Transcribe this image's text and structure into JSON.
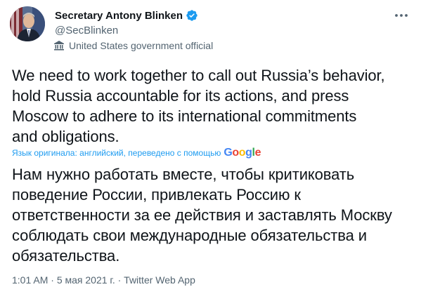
{
  "author": {
    "display_name": "Secretary Antony Blinken",
    "handle": "@SecBlinken",
    "label": "United States government official"
  },
  "tweet": {
    "text": "We need to work together to call out Russia’s behavior,\nhold Russia accountable for its actions, and press\nMoscow to adhere to its international commitments\nand obligations.",
    "translation_label": "Язык оригинала: английский, переведено с помощью",
    "translation_provider": [
      "G",
      "o",
      "o",
      "g",
      "l",
      "e"
    ],
    "translated_text": "Нам нужно работать вместе, чтобы критиковать\nповедение России, привлекать Россию к\nответственности за ее действия и заставлять Москву\nсоблюдать свои международные обязательства и\nобязательства."
  },
  "meta": {
    "time": "1:01 AM",
    "separator": "·",
    "date": "5 мая 2021 г.",
    "source": "Twitter Web App"
  },
  "colors": {
    "accent": "#1d9bf0",
    "secondary_text": "#536471",
    "primary_text": "#0f1419",
    "google": [
      "#4285f4",
      "#ea4335",
      "#fbbc05",
      "#4285f4",
      "#34a853",
      "#ea4335"
    ]
  },
  "icons": {
    "verified": "verified-badge-icon",
    "government": "government-building-icon",
    "more": "more-options-icon"
  }
}
